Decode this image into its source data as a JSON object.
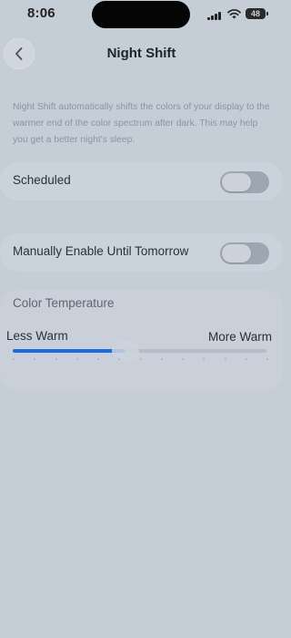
{
  "status_bar": {
    "time": "8:06",
    "battery": "48"
  },
  "nav": {
    "title": "Night Shift"
  },
  "description": "Night Shift automatically shifts the colors of your display to the warmer end of the color spectrum after dark. This may help you get a better night's sleep.",
  "scheduled": {
    "label": "Scheduled",
    "enabled": false
  },
  "manual": {
    "label": "Manually Enable Until Tomorrow",
    "enabled": false
  },
  "color_temperature": {
    "title": "Color Temperature",
    "min_label": "Less Warm",
    "max_label": "More Warm",
    "level": 0.44
  },
  "colors": {
    "accent": "#1e6ae0",
    "background": "#c5cdd7"
  }
}
